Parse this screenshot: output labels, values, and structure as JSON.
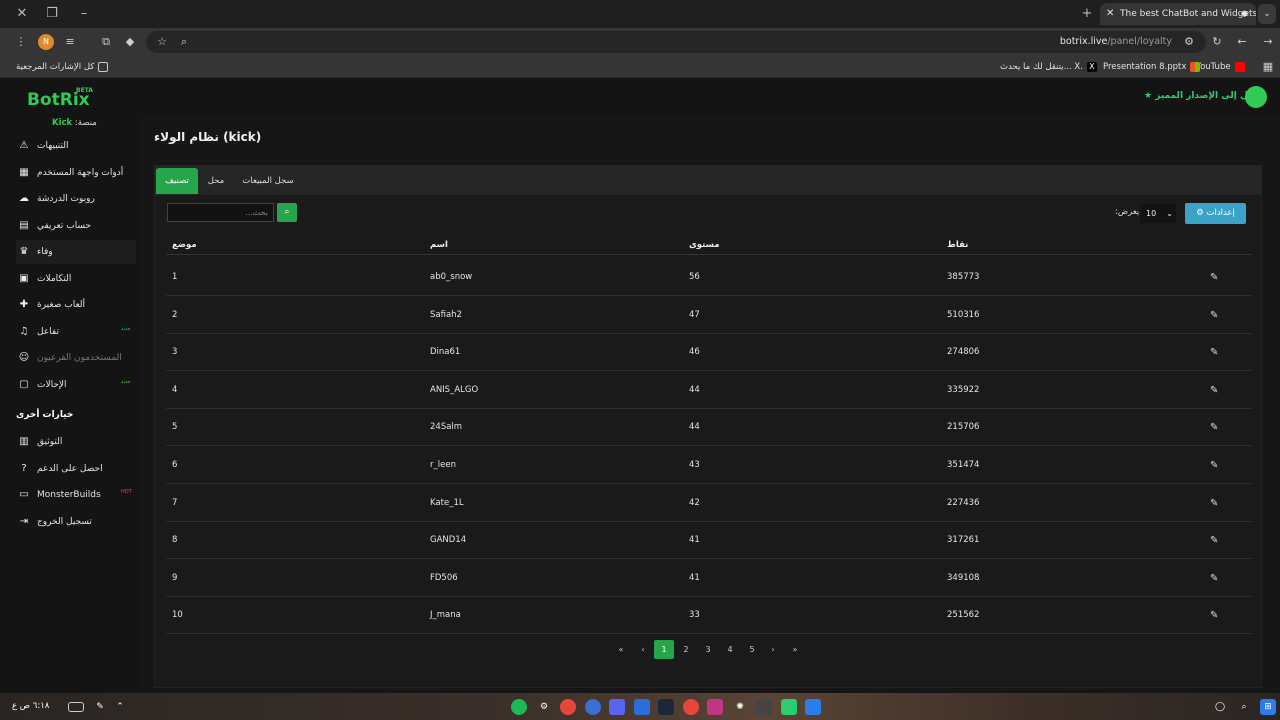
{
  "browser": {
    "tab_title": "The best ChatBot and Widgets",
    "url_domain": "botrix.live",
    "url_path": "/panel/loyalty",
    "bookmarks_all": "كل الإشارات المرجعية",
    "bookmarks": [
      {
        "label": "YouTube",
        "color": "#ff0000"
      },
      {
        "label": "Presentation 8.pptx",
        "color": "#f25022"
      },
      {
        "label": "يتنقل لك ما يحدث... X.",
        "color": "#000000"
      }
    ],
    "profile_initial": "N"
  },
  "app": {
    "logo": "BotRix",
    "beta": "BETA",
    "premium": "انتقل إلى الإصدار المميز",
    "platform_label": "منصة:",
    "platform_value": "Kick",
    "accent": "#26a64a"
  },
  "sidebar": {
    "items": [
      {
        "label": "التنبيهات",
        "icon": "warning-icon",
        "glyph": "⚠"
      },
      {
        "label": "أدوات واجهة المستخدم",
        "icon": "grid-icon",
        "glyph": "▦"
      },
      {
        "label": "روبوت الدردشة",
        "icon": "robot-icon",
        "glyph": "☁"
      },
      {
        "label": "حساب تعريفي",
        "icon": "id-card-icon",
        "glyph": "▤"
      },
      {
        "label": "وفاء",
        "icon": "trophy-icon",
        "glyph": "♛"
      },
      {
        "label": "التكاملات",
        "icon": "box-icon",
        "glyph": "▣"
      },
      {
        "label": "ألعاب صغيرة",
        "icon": "gamepad-icon",
        "glyph": "✚"
      },
      {
        "label": "تفاعل",
        "icon": "music-icon",
        "glyph": "♫",
        "badge": "جديد"
      },
      {
        "label": "المستخدمون الفرعيون",
        "icon": "users-icon",
        "glyph": "☺"
      },
      {
        "label": "الإحالات",
        "icon": "referral-icon",
        "glyph": "▢",
        "badge": "جديد"
      }
    ],
    "other_title": "خيارات أخرى",
    "other": [
      {
        "label": "التوثيق",
        "icon": "book-icon",
        "glyph": "▥"
      },
      {
        "label": "احصل على الدعم",
        "icon": "help-icon",
        "glyph": "?"
      },
      {
        "label": "MonsterBuilds",
        "icon": "monitor-icon",
        "glyph": "▭",
        "hot": "HOT"
      },
      {
        "label": "تسجيل الخروج",
        "icon": "logout-icon",
        "glyph": "⇥"
      }
    ]
  },
  "main": {
    "title": "نظام الولاء (kick)",
    "tabs": [
      "تصنيف",
      "محل",
      "سجل المبيعات"
    ],
    "search_placeholder": "بحث...",
    "settings_label": "إعدادات",
    "show_label": "يعرض:",
    "page_size": "10",
    "columns": {
      "position": "موضع",
      "name": "اسم",
      "level": "مستوى",
      "points": "نقاط"
    },
    "rows": [
      {
        "pos": "1",
        "name": "ab0_snow",
        "level": "56",
        "points": "385773"
      },
      {
        "pos": "2",
        "name": "Safiah2",
        "level": "47",
        "points": "510316"
      },
      {
        "pos": "3",
        "name": "Dina61",
        "level": "46",
        "points": "274806"
      },
      {
        "pos": "4",
        "name": "ANIS_ALGO",
        "level": "44",
        "points": "335922"
      },
      {
        "pos": "5",
        "name": "24Salm",
        "level": "44",
        "points": "215706"
      },
      {
        "pos": "6",
        "name": "r_leen",
        "level": "43",
        "points": "351474"
      },
      {
        "pos": "7",
        "name": "Kate_1L",
        "level": "42",
        "points": "227436"
      },
      {
        "pos": "8",
        "name": "GAND14",
        "level": "41",
        "points": "317261"
      },
      {
        "pos": "9",
        "name": "FD506",
        "level": "41",
        "points": "349108"
      },
      {
        "pos": "10",
        "name": "J_mana",
        "level": "33",
        "points": "251562"
      }
    ],
    "pagination": {
      "pages": [
        "1",
        "2",
        "3",
        "4",
        "5"
      ],
      "current": "1"
    }
  },
  "taskbar": {
    "time": "٦:١٨ ص",
    "lang": "ع"
  }
}
